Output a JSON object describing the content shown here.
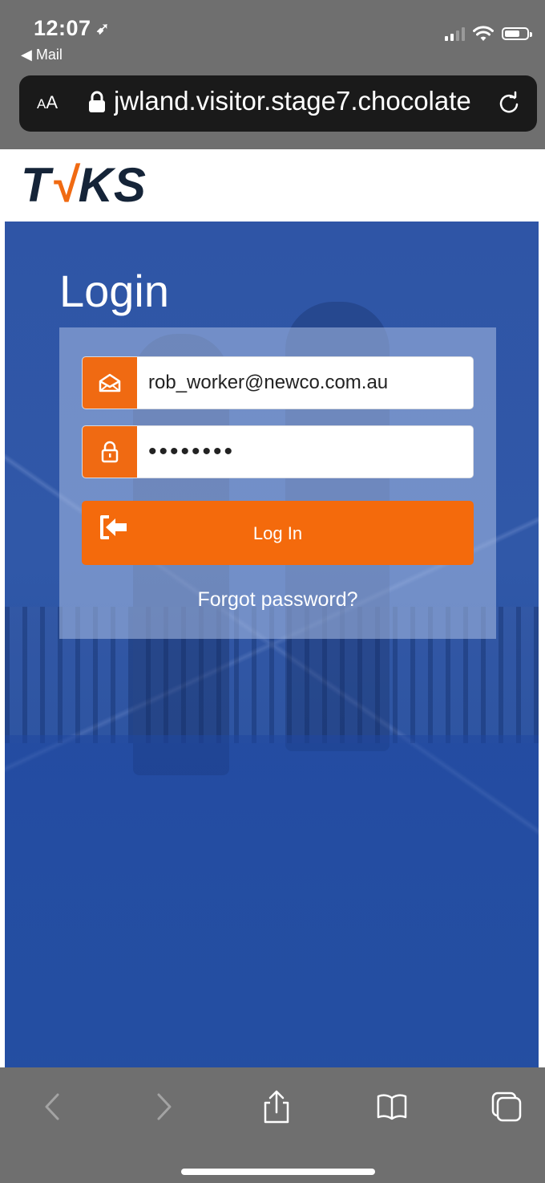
{
  "status_bar": {
    "time": "12:07",
    "back_label": "◀ Mail"
  },
  "browser": {
    "text_size_label_small": "A",
    "text_size_label_large": "A",
    "url": "jwland.visitor.stage7.chocolate"
  },
  "brand": {
    "logo_before": "T",
    "logo_tick": "√",
    "logo_after": "KS",
    "accent_color": "#f06a12",
    "navy_color": "#152438"
  },
  "login": {
    "title": "Login",
    "email_value": "rob_worker@newco.com.au",
    "password_value": "••••••••",
    "button_label": "Log In",
    "forgot_label": "Forgot password?"
  },
  "icons": {
    "email": "envelope-icon",
    "password": "lock-icon",
    "login": "sign-in-icon",
    "back": "chevron-left-icon",
    "forward": "chevron-right-icon",
    "share": "share-icon",
    "bookmarks": "book-icon",
    "tabs": "tabs-icon"
  }
}
